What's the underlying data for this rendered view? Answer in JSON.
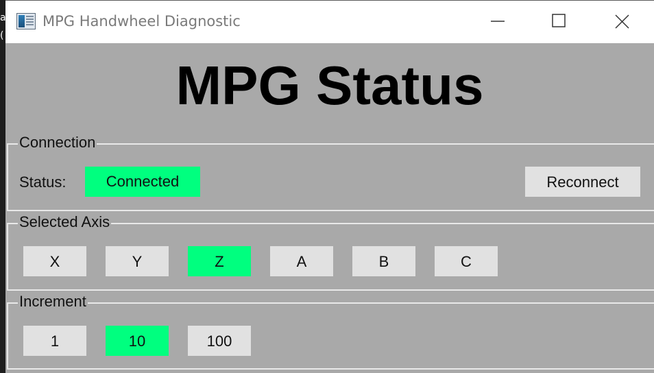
{
  "window": {
    "title": "MPG Handwheel Diagnostic",
    "controls": [
      "minimize",
      "maximize",
      "close"
    ]
  },
  "heading": "MPG Status",
  "connection": {
    "group_label": "Connection",
    "status_label": "Status:",
    "status_value": "Connected",
    "status_color": "#00ff7f",
    "reconnect_label": "Reconnect"
  },
  "axis": {
    "group_label": "Selected Axis",
    "buttons": [
      "X",
      "Y",
      "Z",
      "A",
      "B",
      "C"
    ],
    "selected": "Z"
  },
  "increment": {
    "group_label": "Increment",
    "buttons": [
      "1",
      "10",
      "100"
    ],
    "selected": "10"
  },
  "colors": {
    "active": "#00ff7f",
    "button": "#e1e1e1",
    "background": "#a9a9a9"
  },
  "background_fragments": [
    "a",
    "("
  ]
}
